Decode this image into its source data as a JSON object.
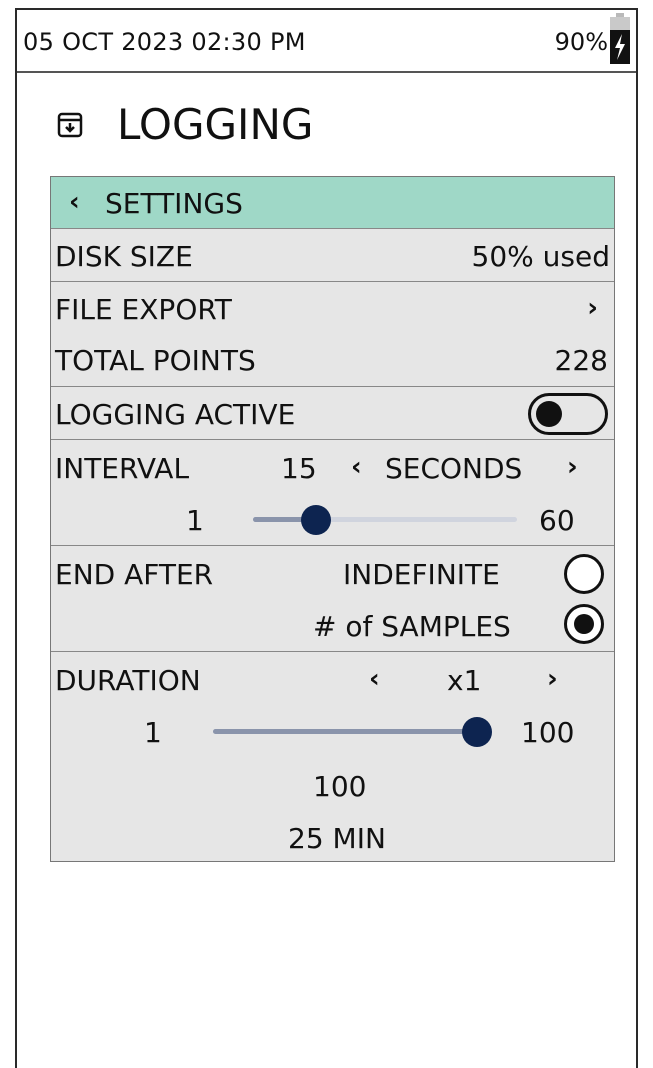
{
  "status": {
    "datetime": "05 OCT 2023 02:30 PM",
    "battery": "90%"
  },
  "page": {
    "title": "LOGGING",
    "title_icon": "archive-download-icon"
  },
  "settings": {
    "header_label": "SETTINGS",
    "header_color": "#9fd8c7",
    "disk_size": {
      "label": "DISK SIZE",
      "value": "50% used"
    },
    "file_export": {
      "label": "FILE EXPORT"
    },
    "total_points": {
      "label": "TOTAL POINTS",
      "value": "228"
    },
    "logging_active": {
      "label": "LOGGING ACTIVE",
      "enabled": false
    },
    "interval": {
      "label": "INTERVAL",
      "value": "15",
      "unit": "SECONDS",
      "min": "1",
      "max": "60",
      "current": 15
    },
    "end_after": {
      "label": "END AFTER",
      "option_indefinite": "INDEFINITE",
      "option_samples": "# of SAMPLES",
      "selected": "# of SAMPLES"
    },
    "duration": {
      "label": "DURATION",
      "multiplier": "x1",
      "min": "1",
      "max": "100",
      "current": 100,
      "samples": "100",
      "time": "25 MIN"
    }
  },
  "colors": {
    "accent": "#0d2450",
    "track": "#8a94ab",
    "track_light": "#d0d4de"
  }
}
